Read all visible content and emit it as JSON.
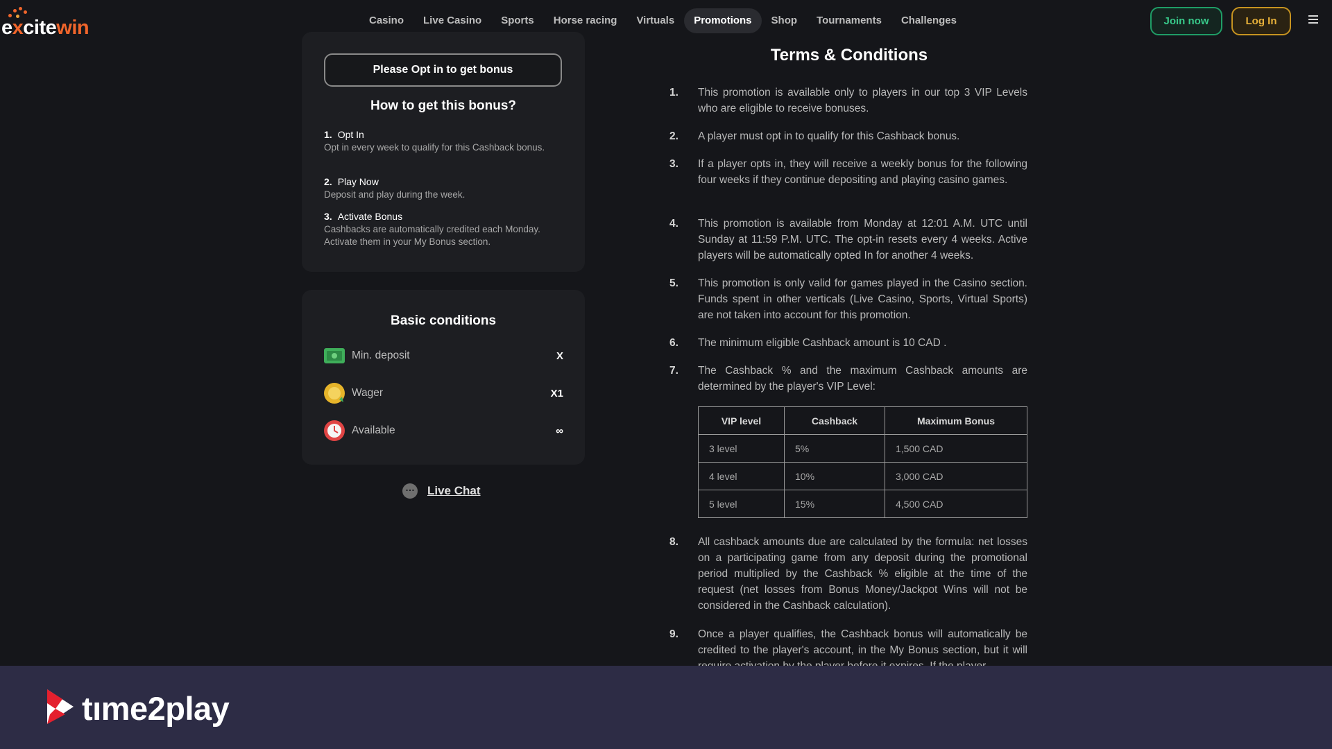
{
  "header": {
    "logo": {
      "part1": "e",
      "part2": "x",
      "part3": "cite",
      "part4": "win"
    },
    "nav": [
      "Casino",
      "Live Casino",
      "Sports",
      "Horse racing",
      "Virtuals",
      "Promotions",
      "Shop",
      "Tournaments",
      "Challenges"
    ],
    "active_nav": "Promotions",
    "join_label": "Join now",
    "login_label": "Log In"
  },
  "bonus_card": {
    "optin_label": "Please Opt in to get bonus",
    "how_title": "How to get this bonus?",
    "steps": [
      {
        "num": "1.",
        "title": "Opt In",
        "desc": "Opt in every week to qualify for this Cashback bonus."
      },
      {
        "num": "2.",
        "title": "Play Now",
        "desc": "Deposit and play during the week."
      },
      {
        "num": "3.",
        "title": "Activate Bonus",
        "desc": "Cashbacks are automatically credited each Monday. Activate them in your My Bonus section."
      }
    ]
  },
  "conditions": {
    "title": "Basic conditions",
    "rows": [
      {
        "label": "Min. deposit",
        "value": "X",
        "icon": "cash-icon"
      },
      {
        "label": "Wager",
        "value": "X1",
        "icon": "coin-icon"
      },
      {
        "label": "Available",
        "value": "∞",
        "icon": "clock-icon"
      }
    ]
  },
  "live_chat_label": "Live Chat",
  "terms": {
    "title": "Terms & Conditions",
    "items": [
      {
        "num": "1.",
        "text": "This promotion is available only to players in our top 3 VIP Levels who are eligible to receive bonuses."
      },
      {
        "num": "2.",
        "text": "A player must opt in to qualify for this Cashback bonus."
      },
      {
        "num": "3.",
        "text": "If a player opts in, they will receive a weekly bonus for the following four weeks if they continue depositing and playing casino games."
      },
      {
        "num": "4.",
        "text": "This promotion is available from Monday at 12:01 A.M. UTC until Sunday at 11:59 P.M. UTC. The opt-in resets every 4 weeks. Active players will be automatically opted In for another 4 weeks."
      },
      {
        "num": "5.",
        "text": "This promotion is only valid for games played in the Casino section. Funds spent in other verticals (Live Casino, Sports, Virtual Sports) are not taken into account for this promotion."
      },
      {
        "num": "6.",
        "text": "The minimum eligible Cashback amount is 10 CAD ."
      },
      {
        "num": "7.",
        "text": "The Cashback % and the maximum Cashback amounts are determined by the player's VIP Level:"
      },
      {
        "num": "8.",
        "text": "All cashback amounts due are calculated by the formula: net losses on a participating game from any deposit during the promotional period multiplied by the Cashback % eligible at the time of the request (net losses from Bonus Money/Jackpot Wins will not be considered in the Cashback calculation)."
      },
      {
        "num": "9.",
        "text": "Once a player qualifies, the Cashback bonus will automatically be credited to the player's account, in the My Bonus section, but it will require activation by the player before it expires. If the player"
      }
    ],
    "table": {
      "headers": [
        "VIP level",
        "Cashback",
        "Maximum Bonus"
      ],
      "rows": [
        [
          "3 level",
          "5%",
          "1,500 CAD"
        ],
        [
          "4 level",
          "10%",
          "3,000 CAD"
        ],
        [
          "5 level",
          "15%",
          "4,500 CAD"
        ]
      ]
    }
  },
  "banner": {
    "brand": "tıme2play"
  },
  "colors": {
    "bg": "#15161a",
    "card": "#1d1e22",
    "brand_orange": "#f0652b",
    "join_green": "#1f9d66",
    "login_gold": "#c69320",
    "banner": "#2d2c45"
  }
}
